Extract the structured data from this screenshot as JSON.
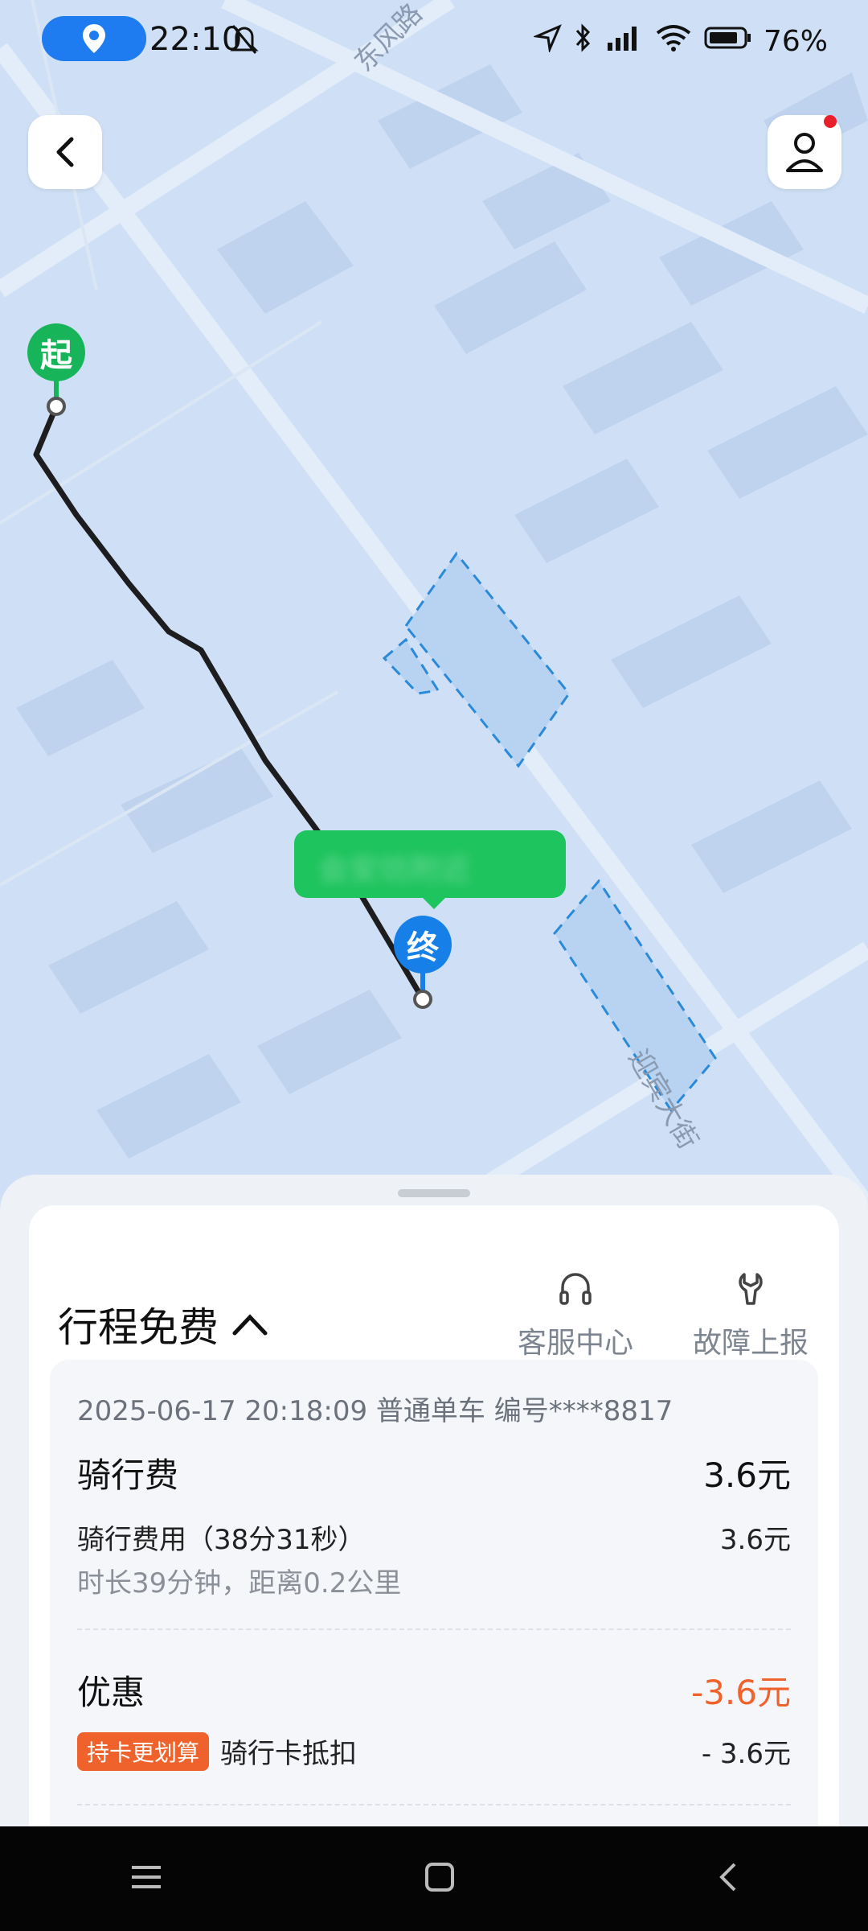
{
  "status_bar": {
    "time": "22:10",
    "battery_percent": "76%",
    "icons": [
      "location-pill-icon",
      "bell-off-icon",
      "navigation-icon",
      "bluetooth-icon",
      "signal-icon",
      "wifi-icon",
      "battery-icon"
    ]
  },
  "map": {
    "road_labels": [
      "东风路",
      "迎宾大街"
    ],
    "start_marker": "起",
    "end_marker": "终",
    "end_bubble_text": "会安坊附近"
  },
  "header": {
    "back_icon": "chevron-left-icon",
    "profile_icon": "user-icon"
  },
  "sheet": {
    "title": "行程免费",
    "actions": [
      {
        "label": "客服中心",
        "icon": "headset-icon"
      },
      {
        "label": "故障上报",
        "icon": "wrench-icon"
      }
    ],
    "trip_meta": "2025-06-17 20:18:09 普通单车 编号****8817",
    "riding_fee_label": "骑行费",
    "riding_fee_value": "3.6元",
    "riding_cost_label": "骑行费用（38分31秒）",
    "riding_cost_value": "3.6元",
    "duration_distance": "时长39分钟，距离0.2公里",
    "discount_label": "优惠",
    "discount_value": "-3.6元",
    "card_tag": "持卡更划算",
    "card_deduct_label": "骑行卡抵扣",
    "card_deduct_value": "- 3.6元"
  },
  "colors": {
    "start": "#18b45a",
    "end": "#1680e8",
    "discount": "#f0622c",
    "map_bg": "#cfe0f6"
  }
}
